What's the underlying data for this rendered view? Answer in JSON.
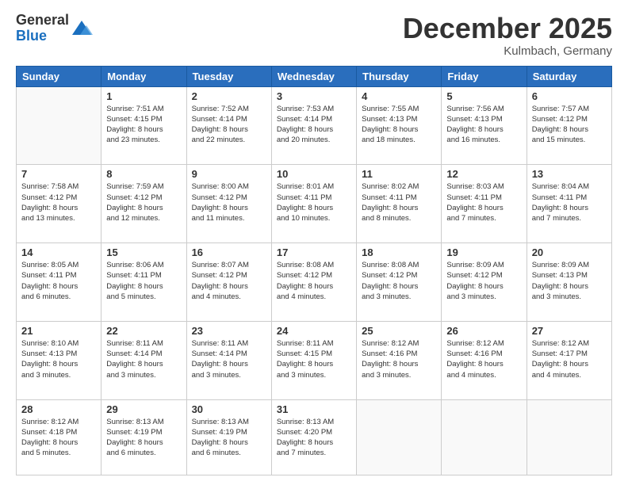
{
  "logo": {
    "general": "General",
    "blue": "Blue"
  },
  "title": "December 2025",
  "location": "Kulmbach, Germany",
  "days_of_week": [
    "Sunday",
    "Monday",
    "Tuesday",
    "Wednesday",
    "Thursday",
    "Friday",
    "Saturday"
  ],
  "weeks": [
    [
      {
        "day": "",
        "info": ""
      },
      {
        "day": "1",
        "info": "Sunrise: 7:51 AM\nSunset: 4:15 PM\nDaylight: 8 hours\nand 23 minutes."
      },
      {
        "day": "2",
        "info": "Sunrise: 7:52 AM\nSunset: 4:14 PM\nDaylight: 8 hours\nand 22 minutes."
      },
      {
        "day": "3",
        "info": "Sunrise: 7:53 AM\nSunset: 4:14 PM\nDaylight: 8 hours\nand 20 minutes."
      },
      {
        "day": "4",
        "info": "Sunrise: 7:55 AM\nSunset: 4:13 PM\nDaylight: 8 hours\nand 18 minutes."
      },
      {
        "day": "5",
        "info": "Sunrise: 7:56 AM\nSunset: 4:13 PM\nDaylight: 8 hours\nand 16 minutes."
      },
      {
        "day": "6",
        "info": "Sunrise: 7:57 AM\nSunset: 4:12 PM\nDaylight: 8 hours\nand 15 minutes."
      }
    ],
    [
      {
        "day": "7",
        "info": "Sunrise: 7:58 AM\nSunset: 4:12 PM\nDaylight: 8 hours\nand 13 minutes."
      },
      {
        "day": "8",
        "info": "Sunrise: 7:59 AM\nSunset: 4:12 PM\nDaylight: 8 hours\nand 12 minutes."
      },
      {
        "day": "9",
        "info": "Sunrise: 8:00 AM\nSunset: 4:12 PM\nDaylight: 8 hours\nand 11 minutes."
      },
      {
        "day": "10",
        "info": "Sunrise: 8:01 AM\nSunset: 4:11 PM\nDaylight: 8 hours\nand 10 minutes."
      },
      {
        "day": "11",
        "info": "Sunrise: 8:02 AM\nSunset: 4:11 PM\nDaylight: 8 hours\nand 8 minutes."
      },
      {
        "day": "12",
        "info": "Sunrise: 8:03 AM\nSunset: 4:11 PM\nDaylight: 8 hours\nand 7 minutes."
      },
      {
        "day": "13",
        "info": "Sunrise: 8:04 AM\nSunset: 4:11 PM\nDaylight: 8 hours\nand 7 minutes."
      }
    ],
    [
      {
        "day": "14",
        "info": "Sunrise: 8:05 AM\nSunset: 4:11 PM\nDaylight: 8 hours\nand 6 minutes."
      },
      {
        "day": "15",
        "info": "Sunrise: 8:06 AM\nSunset: 4:11 PM\nDaylight: 8 hours\nand 5 minutes."
      },
      {
        "day": "16",
        "info": "Sunrise: 8:07 AM\nSunset: 4:12 PM\nDaylight: 8 hours\nand 4 minutes."
      },
      {
        "day": "17",
        "info": "Sunrise: 8:08 AM\nSunset: 4:12 PM\nDaylight: 8 hours\nand 4 minutes."
      },
      {
        "day": "18",
        "info": "Sunrise: 8:08 AM\nSunset: 4:12 PM\nDaylight: 8 hours\nand 3 minutes."
      },
      {
        "day": "19",
        "info": "Sunrise: 8:09 AM\nSunset: 4:12 PM\nDaylight: 8 hours\nand 3 minutes."
      },
      {
        "day": "20",
        "info": "Sunrise: 8:09 AM\nSunset: 4:13 PM\nDaylight: 8 hours\nand 3 minutes."
      }
    ],
    [
      {
        "day": "21",
        "info": "Sunrise: 8:10 AM\nSunset: 4:13 PM\nDaylight: 8 hours\nand 3 minutes."
      },
      {
        "day": "22",
        "info": "Sunrise: 8:11 AM\nSunset: 4:14 PM\nDaylight: 8 hours\nand 3 minutes."
      },
      {
        "day": "23",
        "info": "Sunrise: 8:11 AM\nSunset: 4:14 PM\nDaylight: 8 hours\nand 3 minutes."
      },
      {
        "day": "24",
        "info": "Sunrise: 8:11 AM\nSunset: 4:15 PM\nDaylight: 8 hours\nand 3 minutes."
      },
      {
        "day": "25",
        "info": "Sunrise: 8:12 AM\nSunset: 4:16 PM\nDaylight: 8 hours\nand 3 minutes."
      },
      {
        "day": "26",
        "info": "Sunrise: 8:12 AM\nSunset: 4:16 PM\nDaylight: 8 hours\nand 4 minutes."
      },
      {
        "day": "27",
        "info": "Sunrise: 8:12 AM\nSunset: 4:17 PM\nDaylight: 8 hours\nand 4 minutes."
      }
    ],
    [
      {
        "day": "28",
        "info": "Sunrise: 8:12 AM\nSunset: 4:18 PM\nDaylight: 8 hours\nand 5 minutes."
      },
      {
        "day": "29",
        "info": "Sunrise: 8:13 AM\nSunset: 4:19 PM\nDaylight: 8 hours\nand 6 minutes."
      },
      {
        "day": "30",
        "info": "Sunrise: 8:13 AM\nSunset: 4:19 PM\nDaylight: 8 hours\nand 6 minutes."
      },
      {
        "day": "31",
        "info": "Sunrise: 8:13 AM\nSunset: 4:20 PM\nDaylight: 8 hours\nand 7 minutes."
      },
      {
        "day": "",
        "info": ""
      },
      {
        "day": "",
        "info": ""
      },
      {
        "day": "",
        "info": ""
      }
    ]
  ]
}
